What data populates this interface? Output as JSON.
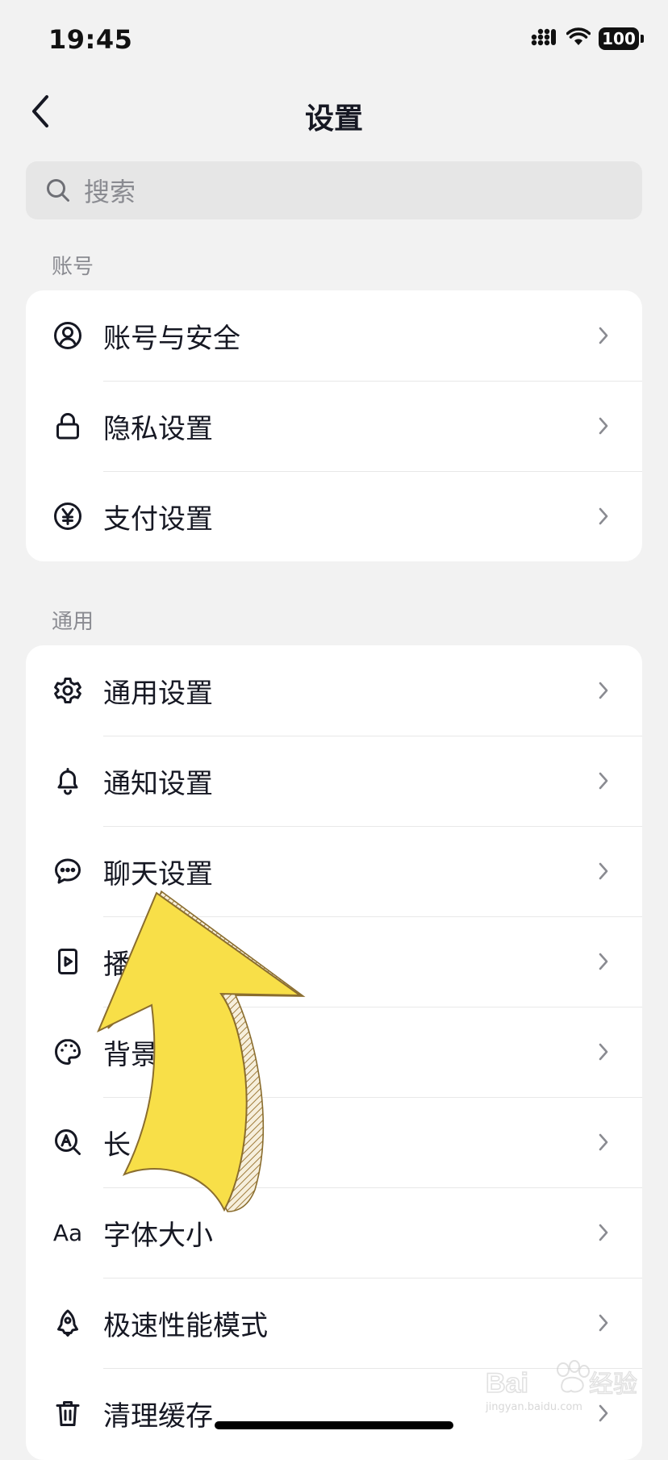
{
  "status_bar": {
    "time": "19:45",
    "battery": "100"
  },
  "header": {
    "title": "设置"
  },
  "search": {
    "placeholder": "搜索"
  },
  "sections": {
    "account": {
      "label": "账号",
      "items": [
        {
          "label": "账号与安全",
          "icon": "user-circle-icon"
        },
        {
          "label": "隐私设置",
          "icon": "lock-icon"
        },
        {
          "label": "支付设置",
          "icon": "yen-circle-icon"
        }
      ]
    },
    "general": {
      "label": "通用",
      "items": [
        {
          "label": "通用设置",
          "icon": "gear-icon"
        },
        {
          "label": "通知设置",
          "icon": "bell-icon"
        },
        {
          "label": "聊天设置",
          "icon": "chat-bubble-icon"
        },
        {
          "label": "播",
          "icon": "play-video-icon"
        },
        {
          "label": "背景",
          "icon": "palette-icon"
        },
        {
          "label": "长",
          "icon": "search-a-icon"
        },
        {
          "label": "字体大小",
          "icon": "font-aa-icon",
          "icon_text": "Aa"
        },
        {
          "label": "极速性能模式",
          "icon": "rocket-icon"
        },
        {
          "label": "清理缓存",
          "icon": "trash-icon"
        }
      ]
    }
  },
  "watermark": {
    "caption": "jingyan.baidu.com"
  },
  "colors": {
    "background": "#f2f2f2",
    "card": "#ffffff",
    "text": "#161823",
    "muted": "#8a8b91",
    "arrow_fill": "#f8df48",
    "arrow_outline": "#8a6d2e"
  }
}
